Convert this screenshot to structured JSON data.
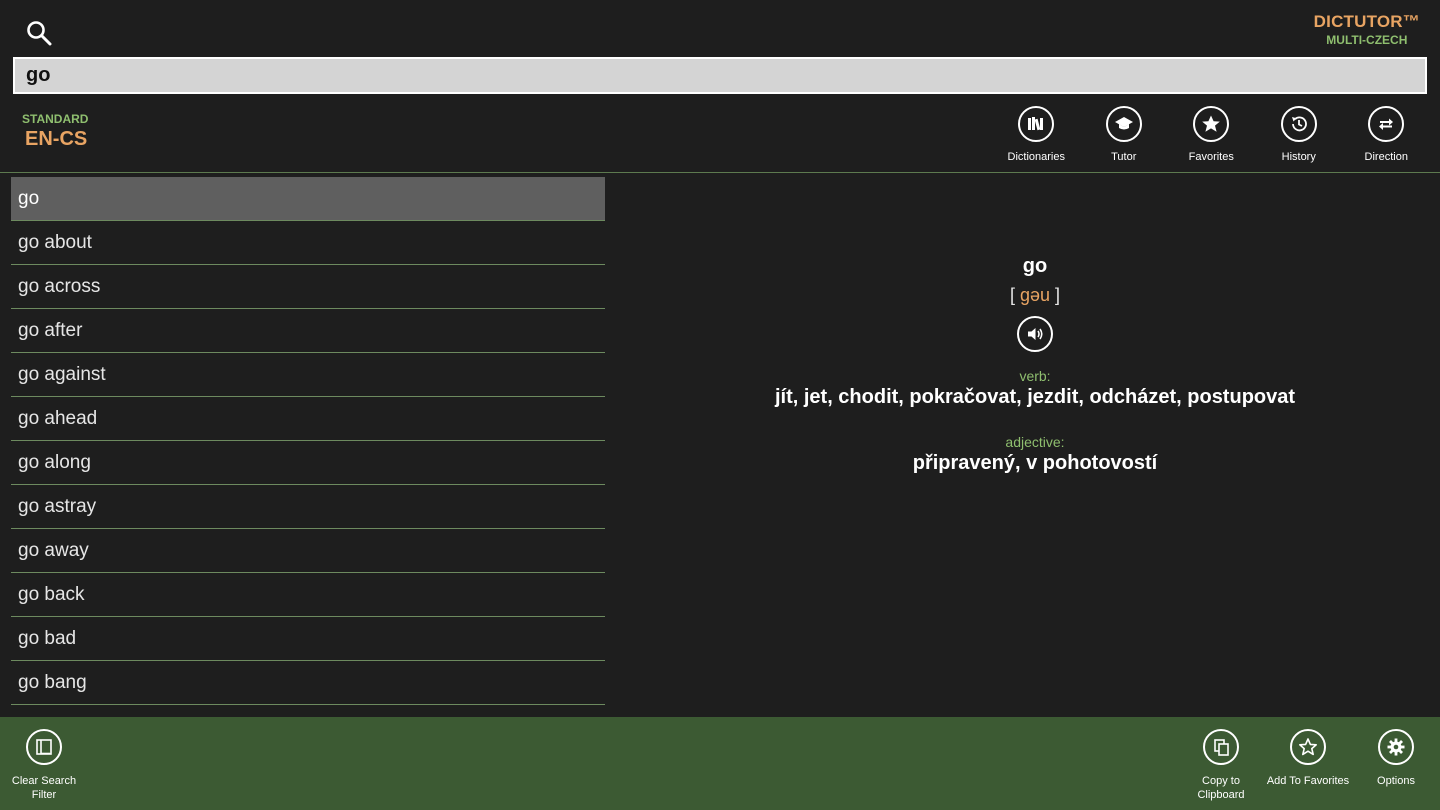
{
  "brand": {
    "title": "DICTUTOR™",
    "subtitle": "MULTI-CZECH"
  },
  "search": {
    "value": "go",
    "placeholder": ""
  },
  "dictionary": {
    "type": "STANDARD",
    "lang": "EN-CS"
  },
  "toolbar": {
    "dictionaries": "Dictionaries",
    "tutor": "Tutor",
    "favorites": "Favorites",
    "history": "History",
    "direction": "Direction"
  },
  "words": [
    "go",
    "go about",
    "go across",
    "go after",
    "go against",
    "go ahead",
    "go along",
    "go astray",
    "go away",
    "go back",
    "go bad",
    "go bang"
  ],
  "entry": {
    "headword": "go",
    "bracket_open": "[",
    "ipa": "gəu",
    "bracket_close": "]",
    "senses": [
      {
        "pos": "verb:",
        "translation": "jít, jet, chodit, pokračovat, jezdit, odcházet, postupovat"
      },
      {
        "pos": "adjective:",
        "translation": "připravený, v pohotovostí"
      }
    ]
  },
  "appbar": {
    "clear_search_filter": "Clear Search\nFilter",
    "copy_to_clipboard": "Copy to\nClipboard",
    "add_to_favorites": "Add To Favorites",
    "options": "Options"
  },
  "colors": {
    "background": "#1e1e1e",
    "accent_orange": "#e8a463",
    "accent_green": "#8fbf6f",
    "appbar": "#3c5a33",
    "selected_row": "#5f5f5f"
  }
}
